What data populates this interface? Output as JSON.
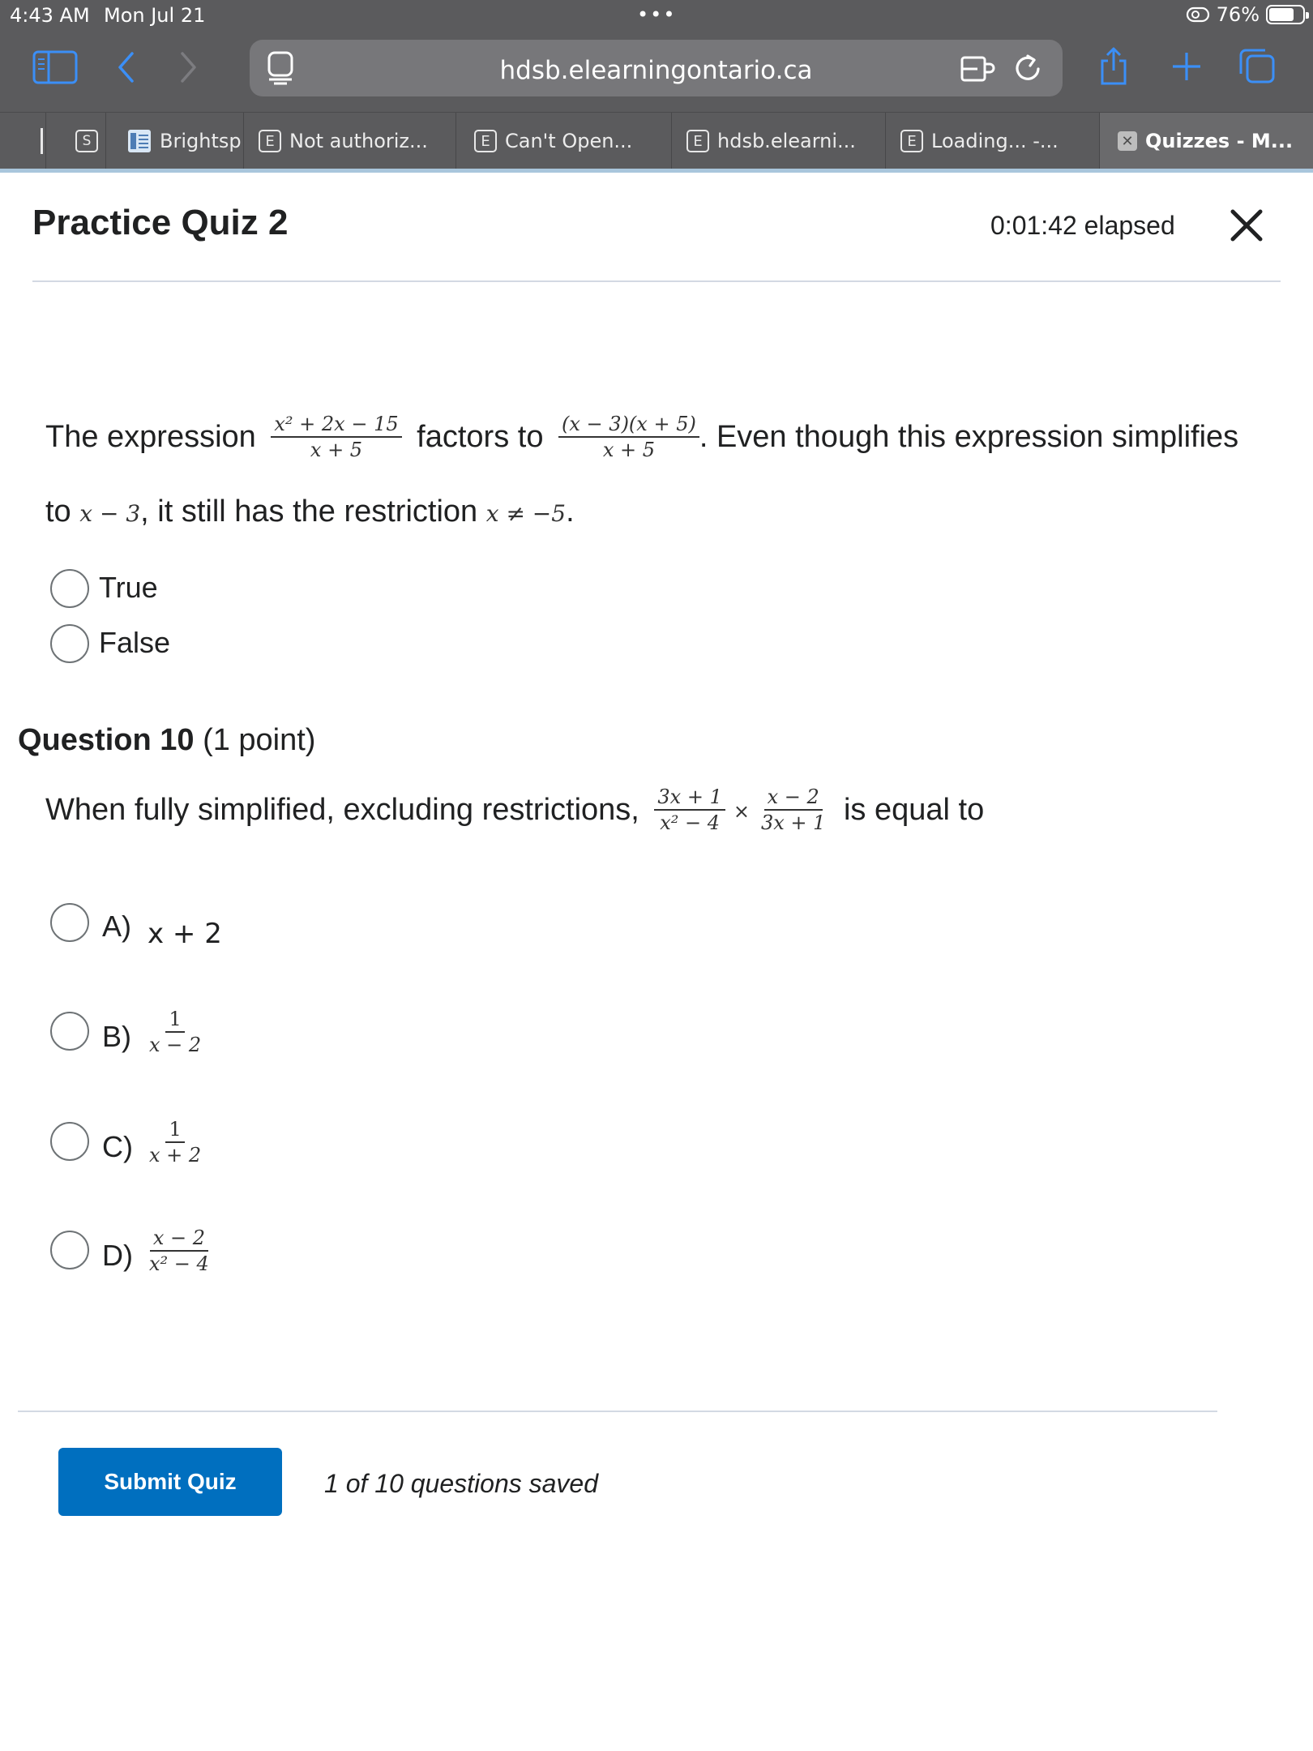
{
  "status_bar": {
    "time": "4:43 AM",
    "date": "Mon Jul 21",
    "battery": "76%",
    "battery_level": 0.76
  },
  "browser": {
    "url": "hdsb.elearningontario.ca",
    "tabs": [
      {
        "label": "Brightsp",
        "favicon": "brightspace-icon"
      },
      {
        "label": "Not authoriz...",
        "favicon": "E"
      },
      {
        "label": "Can't Open...",
        "favicon": "E"
      },
      {
        "label": "hdsb.elearni...",
        "favicon": "E"
      },
      {
        "label": "Loading... -...",
        "favicon": "E"
      },
      {
        "label": "Quizzes - M...",
        "favicon": "x",
        "active": true
      }
    ]
  },
  "quiz": {
    "title": "Practice Quiz 2",
    "elapsed": "0:01:42 elapsed"
  },
  "question9": {
    "part1": "The expression",
    "frac1_num": "x² + 2x − 15",
    "frac1_den": "x + 5",
    "part2": "factors to",
    "frac2_num": "(x − 3)(x + 5)",
    "frac2_den": "x + 5",
    "part3": ". Even though this expression simplifies",
    "part4": "to",
    "math1": "x − 3",
    "part5": ", it still has the restriction",
    "math2": "x ≠ −5",
    "part6": ".",
    "options": [
      "True",
      "False"
    ]
  },
  "question10": {
    "heading": "Question 10",
    "points": "(1 point)",
    "prompt": "When fully simplified, excluding restrictions,",
    "frac1_num": "3x + 1",
    "frac1_den": "x² − 4",
    "times": "×",
    "frac2_num": "x − 2",
    "frac2_den": "3x + 1",
    "suffix": "is equal to",
    "options": [
      {
        "letter": "A)",
        "text": "x + 2"
      },
      {
        "letter": "B)",
        "num": "1",
        "den": "x − 2"
      },
      {
        "letter": "C)",
        "num": "1",
        "den": "x + 2"
      },
      {
        "letter": "D)",
        "num": "x − 2",
        "den": "x² − 4"
      }
    ]
  },
  "footer": {
    "submit_label": "Submit Quiz",
    "saved_text": "1 of 10 questions saved"
  },
  "colors": {
    "chrome": "#5b5b5d",
    "submit": "#006fbf",
    "accent_link": "#3b8ff7"
  }
}
